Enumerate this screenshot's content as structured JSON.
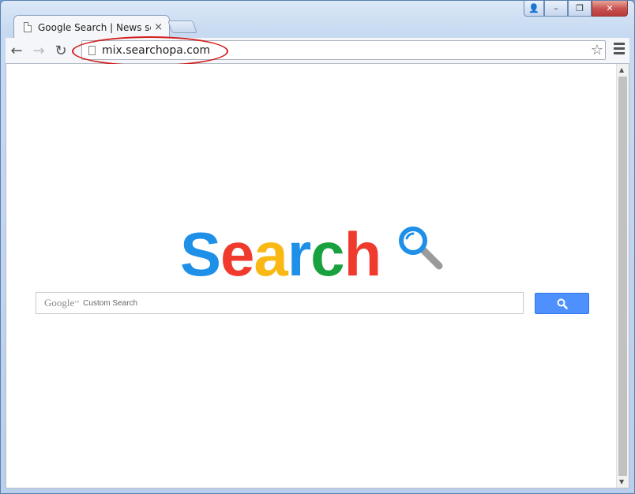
{
  "tab": {
    "title": "Google Search | News sea",
    "close": "×"
  },
  "window_controls": {
    "user": "👤",
    "minimize": "–",
    "maximize": "❐",
    "close": "✕"
  },
  "toolbar": {
    "back": "←",
    "forward": "→",
    "reload": "↻",
    "url": "mix.searchopa.com",
    "star": "☆"
  },
  "logo": {
    "letters": [
      "S",
      "e",
      "a",
      "r",
      "c",
      "h"
    ],
    "colors": [
      "#1e90e8",
      "#f03a2e",
      "#f9b813",
      "#1e90e8",
      "#19a13e",
      "#f03a2e"
    ]
  },
  "search": {
    "brand": "Google",
    "trademark": "™",
    "placeholder": "Custom Search"
  },
  "scrollbar": {
    "up": "▲",
    "down": "▼"
  }
}
